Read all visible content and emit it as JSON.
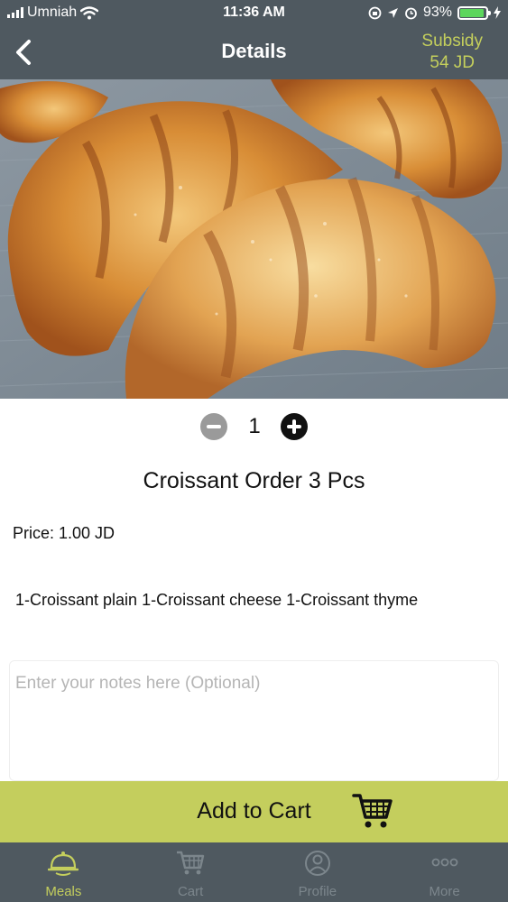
{
  "status_bar": {
    "carrier": "Umniah",
    "time": "11:36 AM",
    "battery": "93%",
    "battery_level": 0.93
  },
  "header": {
    "title": "Details",
    "subsidy_label": "Subsidy",
    "subsidy_value": "54 JD"
  },
  "hero": {
    "icon": "croissant-photo"
  },
  "quantity": {
    "value": "1"
  },
  "item": {
    "name": "Croissant Order 3 Pcs",
    "price": "Price: 1.00 JD",
    "description": "1-Croissant plain  1-Croissant cheese  1-Croissant thyme"
  },
  "notes": {
    "placeholder": "Enter your notes here (Optional)",
    "value": ""
  },
  "add_to_cart": {
    "label": "Add to Cart"
  },
  "tabs": [
    {
      "label": "Meals",
      "icon": "meals-icon",
      "active": true
    },
    {
      "label": "Cart",
      "icon": "cart-icon",
      "active": false
    },
    {
      "label": "Profile",
      "icon": "profile-icon",
      "active": false
    },
    {
      "label": "More",
      "icon": "more-icon",
      "active": false
    }
  ],
  "colors": {
    "bar_bg": "#4f5960",
    "accent": "#c4ce5d",
    "inactive_tab": "#7c868c"
  }
}
